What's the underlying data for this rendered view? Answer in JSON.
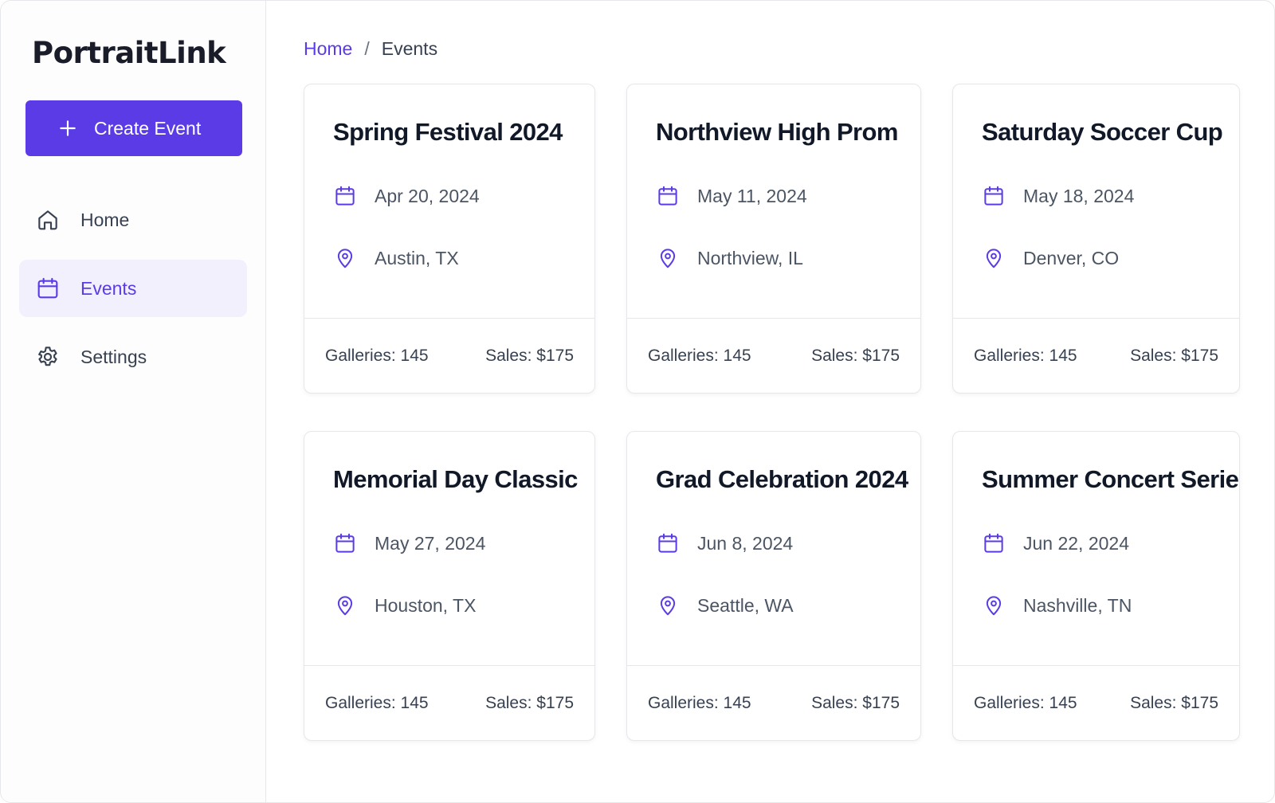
{
  "app": {
    "name": "PortraitLink"
  },
  "sidebar": {
    "create_label": "Create Event",
    "items": [
      {
        "label": "Home",
        "icon": "home-icon",
        "active": false
      },
      {
        "label": "Events",
        "icon": "calendar-icon",
        "active": true
      },
      {
        "label": "Settings",
        "icon": "gear-icon",
        "active": false
      }
    ]
  },
  "breadcrumb": {
    "home": "Home",
    "separator": "/",
    "current": "Events"
  },
  "events": [
    {
      "title": "Spring Festival 2024",
      "date": "Apr 20, 2024",
      "location": "Austin, TX",
      "galleries": "Galleries:  145",
      "sales": "Sales:  $175"
    },
    {
      "title": "Northview High Prom",
      "date": "May 11, 2024",
      "location": "Northview, IL",
      "galleries": "Galleries:  145",
      "sales": "Sales:  $175"
    },
    {
      "title": "Saturday Soccer Cup",
      "date": "May 18, 2024",
      "location": "Denver, CO",
      "galleries": "Galleries:  145",
      "sales": "Sales:  $175"
    },
    {
      "title": "Memorial Day Classic",
      "date": "May 27, 2024",
      "location": "Houston, TX",
      "galleries": "Galleries:  145",
      "sales": "Sales:  $175"
    },
    {
      "title": "Grad Celebration 2024",
      "date": "Jun 8, 2024",
      "location": "Seattle, WA",
      "galleries": "Galleries:  145",
      "sales": "Sales:  $175"
    },
    {
      "title": "Summer Concert Series",
      "date": "Jun 22, 2024",
      "location": "Nashville, TN",
      "galleries": "Galleries:  145",
      "sales": "Sales:  $175"
    }
  ],
  "colors": {
    "accent": "#5b3be6",
    "active_bg": "#f3f0fd",
    "border": "#e5e7eb"
  }
}
